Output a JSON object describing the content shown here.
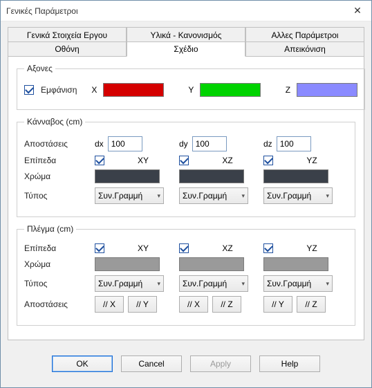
{
  "title": "Γενικές Παράμετροι",
  "tabs": {
    "row1": [
      "Γενικά Στοιχεία Εργου",
      "Υλικά - Κανονισμός",
      "Αλλες Παράμετροι"
    ],
    "row2": [
      "Οθόνη",
      "Σχέδιο",
      "Απεικόνιση"
    ],
    "active": "Σχέδιο"
  },
  "axes": {
    "legend": "Αξονες",
    "show_label": "Εμφάνιση",
    "show_checked": true,
    "items": [
      {
        "label": "X",
        "color": "#d40000"
      },
      {
        "label": "Y",
        "color": "#00d300"
      },
      {
        "label": "Z",
        "color": "#8a8aff"
      }
    ]
  },
  "grid": {
    "legend": "Κάνναβος (cm)",
    "distances_label": "Αποστάσεις",
    "dx_label": "dx",
    "dx": "100",
    "dy_label": "dy",
    "dy": "100",
    "dz_label": "dz",
    "dz": "100",
    "planes_label": "Επίπεδα",
    "planes": [
      {
        "label": "XY",
        "checked": true
      },
      {
        "label": "XZ",
        "checked": true
      },
      {
        "label": "YZ",
        "checked": true
      }
    ],
    "color_label": "Χρώμα",
    "color": "#3a4049",
    "type_label": "Τύπος",
    "type_value": "Συν.Γραμμή"
  },
  "mesh": {
    "legend": "Πλέγμα (cm)",
    "planes_label": "Επίπεδα",
    "planes": [
      {
        "label": "XY",
        "checked": true
      },
      {
        "label": "XZ",
        "checked": true
      },
      {
        "label": "YZ",
        "checked": true
      }
    ],
    "color_label": "Χρώμα",
    "color": "#9a9a9a",
    "type_label": "Τύπος",
    "type_value": "Συν.Γραμμή",
    "distances_label": "Αποστάσεις",
    "distance_buttons": [
      [
        "// X",
        "// Y"
      ],
      [
        "// X",
        "// Z"
      ],
      [
        "// Y",
        "// Z"
      ]
    ]
  },
  "footer": {
    "ok": "OK",
    "cancel": "Cancel",
    "apply": "Apply",
    "help": "Help"
  }
}
